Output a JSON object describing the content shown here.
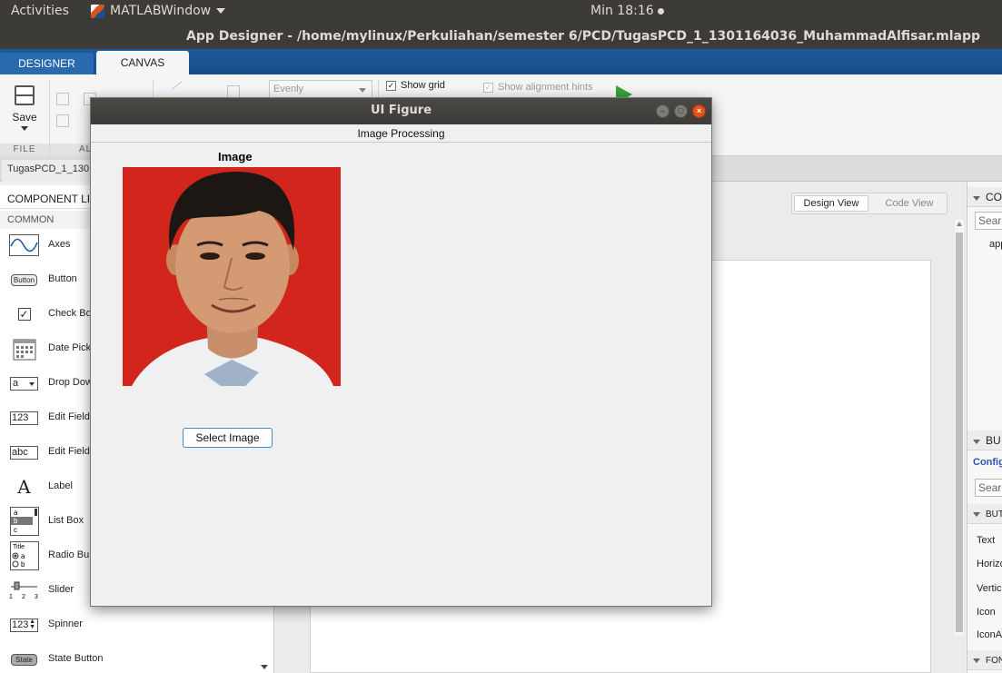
{
  "topbar": {
    "activities": "Activities",
    "app_menu": "MATLABWindow",
    "clock": "Min 18:16"
  },
  "window": {
    "title": "App Designer - /home/mylinux/Perkuliahan/semester 6/PCD/TugasPCD_1_1301164036_MuhammadAlfisar.mlapp"
  },
  "toolstrip": {
    "tabs": [
      {
        "label": "DESIGNER",
        "active": false
      },
      {
        "label": "CANVAS",
        "active": true
      }
    ],
    "save_label": "Save",
    "group_file": "FILE",
    "group_align": "AL",
    "spacing_select": "Evenly",
    "show_grid": {
      "label": "Show grid",
      "checked": true
    },
    "show_hints": {
      "label": "Show alignment hints",
      "checked": true
    }
  },
  "file_tab": {
    "label": "TugasPCD_1_130"
  },
  "library": {
    "header": "COMPONENT LI",
    "section": "COMMON",
    "items": [
      {
        "label": "Axes",
        "icon": "axes-icon"
      },
      {
        "label": "Button",
        "icon": "button-icon",
        "icon_text": "Button"
      },
      {
        "label": "Check Bo",
        "icon": "checkbox-icon",
        "icon_text": "✓"
      },
      {
        "label": "Date Pick",
        "icon": "calendar-icon"
      },
      {
        "label": "Drop Dow",
        "icon": "dropdown-icon",
        "icon_text": "a"
      },
      {
        "label": "Edit Field",
        "icon": "numeric-field-icon",
        "icon_text": "123"
      },
      {
        "label": "Edit Field",
        "icon": "text-field-icon",
        "icon_text": "abc"
      },
      {
        "label": "Label",
        "icon": "label-icon",
        "icon_text": "A"
      },
      {
        "label": "List Box",
        "icon": "listbox-icon"
      },
      {
        "label": "Radio Bu",
        "icon": "radio-group-icon"
      },
      {
        "label": "Slider",
        "icon": "slider-icon"
      },
      {
        "label": "Spinner",
        "icon": "spinner-icon",
        "icon_text": "123"
      },
      {
        "label": "State Button",
        "icon": "state-button-icon",
        "icon_text": "State"
      }
    ]
  },
  "canvas": {
    "design_view": "Design View",
    "code_view": "Code View"
  },
  "inspector": {
    "browser_header": "CO",
    "browser_search": "Searc",
    "browser_item": "app",
    "props_header": "BU",
    "props_link": "Config",
    "props_search": "Searc",
    "section_button": "BUT",
    "props": [
      "Text",
      "Horizo",
      "Vertic",
      "Icon",
      "IconA"
    ],
    "section_font": "FON"
  },
  "uifigure": {
    "title": "UI Figure",
    "panel_title": "Image Processing",
    "image_label": "Image",
    "select_button": "Select Image"
  }
}
